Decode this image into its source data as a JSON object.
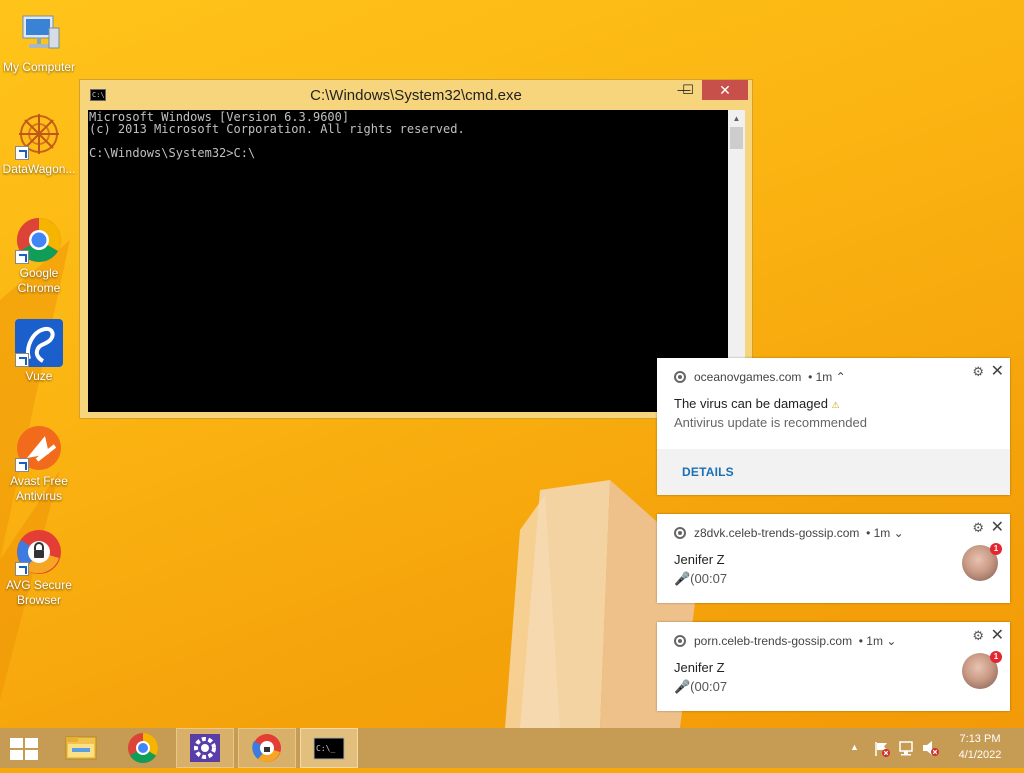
{
  "desktop_icons": [
    {
      "label": "My Computer",
      "icon": "computer-icon"
    },
    {
      "label": "DataWagon...",
      "icon": "datawagon-icon"
    },
    {
      "label": "Google Chrome",
      "icon": "chrome-icon"
    },
    {
      "label": "Vuze",
      "icon": "vuze-frog-icon"
    },
    {
      "label": "Avast Free Antivirus",
      "icon": "avast-icon"
    },
    {
      "label": "AVG Secure Browser",
      "icon": "avg-browser-icon"
    }
  ],
  "cmd_window": {
    "title": "C:\\Windows\\System32\\cmd.exe",
    "minimize": "—",
    "maximize": "☐",
    "close": "✕",
    "console_lines": [
      "Microsoft Windows [Version 6.3.9600]",
      "(c) 2013 Microsoft Corporation. All rights reserved.",
      "",
      "C:\\Windows\\System32>C:\\"
    ]
  },
  "notifications": [
    {
      "source": "oceanovgames.com",
      "time": "• 1m",
      "chevron": "⌃",
      "title": "The virus can be damaged",
      "title_suffix": "⚠",
      "body": "Antivirus update is recommended",
      "action": "DETAILS"
    },
    {
      "source": "z8dvk.celeb-trends-gossip.com",
      "time": "• 1m",
      "chevron": "⌄",
      "title": "Jenifer Z",
      "body": "🎤(00:07",
      "badge": "1"
    },
    {
      "source": "porn.celeb-trends-gossip.com",
      "time": "• 1m",
      "chevron": "⌄",
      "title": "Jenifer Z",
      "body": "🎤(00:07",
      "badge": "1"
    }
  ],
  "taskbar": {
    "apps": [
      "file-explorer-icon",
      "chrome-icon",
      "settings-gear-icon",
      "avg-browser-icon",
      "cmd-icon"
    ],
    "cmd_glyph": "C:\\_",
    "tray_up": "▲",
    "time": "7:13 PM",
    "date": "4/1/2022"
  },
  "colors": {
    "wallpaper": "#f7a90c",
    "taskbar": "#c69b54",
    "close_button": "#c7504a",
    "action_link": "#1c6fb5"
  }
}
